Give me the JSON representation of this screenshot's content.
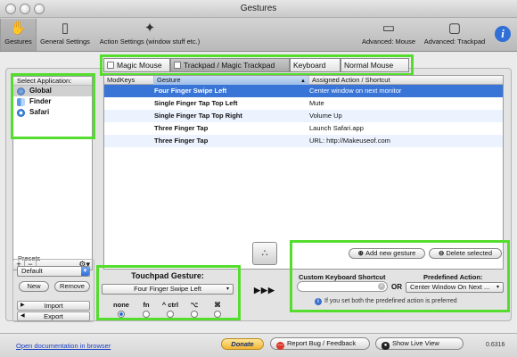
{
  "window": {
    "title": "Gestures"
  },
  "toolbar": {
    "gestures": "Gestures",
    "general_settings": "General Settings",
    "action_settings": "Action Settings (window stuff etc.)",
    "advanced_mouse": "Advanced: Mouse",
    "advanced_trackpad": "Advanced: Trackpad",
    "info_icon": "i"
  },
  "segments": [
    "Magic Mouse",
    "Trackpad / Magic Trackpad",
    "Keyboard",
    "Normal Mouse"
  ],
  "app_list": {
    "header": "Select Application:",
    "items": [
      "Global",
      "Finder",
      "Safari"
    ],
    "add": "+",
    "remove": "−",
    "gear": "⚙▾"
  },
  "table": {
    "columns": [
      "ModKeys",
      "Gesture",
      "Assigned Action / Shortcut"
    ],
    "rows": [
      {
        "modkeys": "",
        "gesture": "Four Finger Swipe Left",
        "action": "Center window on next monitor"
      },
      {
        "modkeys": "",
        "gesture": "Single Finger Tap Top Left",
        "action": "Mute"
      },
      {
        "modkeys": "",
        "gesture": "Single Finger Tap Top Right",
        "action": "Volume Up"
      },
      {
        "modkeys": "",
        "gesture": "Three Finger Tap",
        "action": "Launch Safari.app"
      },
      {
        "modkeys": "",
        "gesture": "Three Finger Tap",
        "action": "URL: http://Makeuseof.com"
      }
    ]
  },
  "presets": {
    "label": "Presets",
    "selected": "Default",
    "new": "New",
    "remove": "Remove",
    "import": "Import",
    "export": "Export"
  },
  "touchpad": {
    "title": "Touchpad Gesture:",
    "selected": "Four Finger Swipe Left",
    "modifiers": [
      "none",
      "fn",
      "^ ctrl",
      "⌥",
      "⌘"
    ],
    "selected_modifier": "none"
  },
  "arrows": "▶▶▶",
  "action_panel": {
    "add_gesture": "Add new gesture",
    "delete_selected": "Delete selected",
    "keyboard_shortcut_label": "Custom Keyboard Shortcut",
    "or": "OR",
    "predefined_label": "Predefined Action:",
    "predefined_selected": "Center Window On Next ...",
    "info": "If you set both the predefined action is preferred"
  },
  "footer": {
    "doc_link": "Open documentation in browser",
    "donate": "Donate",
    "report_bug": "Report Bug / Feedback",
    "live_view": "Show Live View",
    "version": "0.6316"
  },
  "colors": {
    "highlight": "#55dd2e",
    "selection": "#3875d7",
    "sorted_header": "#9dbde8"
  }
}
